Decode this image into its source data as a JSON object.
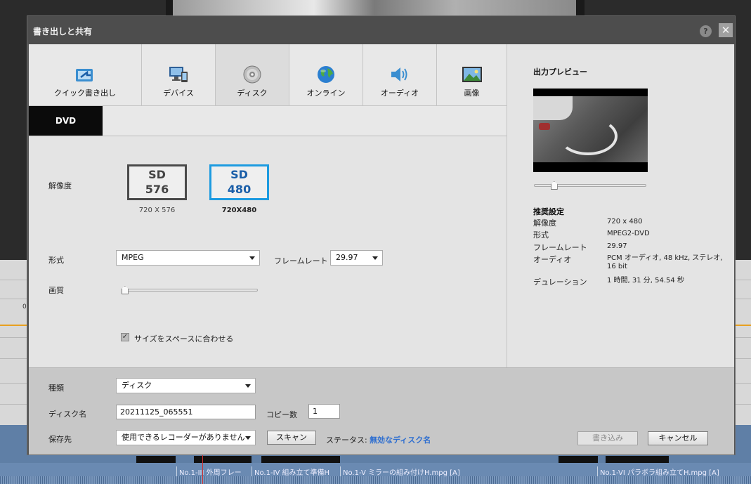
{
  "dialog": {
    "title": "書き出しと共有",
    "help_label": "?",
    "close_label": "✕"
  },
  "tabs": [
    {
      "label": "クイック書き出し",
      "icon": "quick-export-icon"
    },
    {
      "label": "デバイス",
      "icon": "device-icon"
    },
    {
      "label": "ディスク",
      "icon": "disc-icon",
      "active": true
    },
    {
      "label": "オンライン",
      "icon": "globe-icon"
    },
    {
      "label": "オーディオ",
      "icon": "speaker-icon"
    },
    {
      "label": "画像",
      "icon": "image-icon"
    }
  ],
  "subtab": {
    "label": "DVD"
  },
  "settings": {
    "resolution_label": "解像度",
    "options": [
      {
        "top": "SD",
        "bottom": "576",
        "caption": "720 X 576",
        "selected": false
      },
      {
        "top": "SD",
        "bottom": "480",
        "caption": "720X480",
        "selected": true
      }
    ],
    "format_label": "形式",
    "format_value": "MPEG",
    "framerate_label": "フレームレート",
    "framerate_value": "29.97",
    "quality_label": "画質",
    "quality_level": 0.02,
    "fit_label": "サイズをスペースに合わせる",
    "fit_checked": true,
    "fit_mark": "✓"
  },
  "preview": {
    "title": "出力プレビュー",
    "scrub_position": 0.18,
    "recommended_title": "推奨設定",
    "items": [
      {
        "key": "解像度",
        "value": "720 x 480"
      },
      {
        "key": "形式",
        "value": "MPEG2-DVD"
      },
      {
        "key": "フレームレート",
        "value": "29.97"
      },
      {
        "key": "オーディオ",
        "value": "PCM オーディオ, 48 kHz, ステレオ, 16 bit"
      },
      {
        "key": "デュレーション",
        "value": "1 時間, 31 分, 54.54 秒"
      }
    ]
  },
  "bottom": {
    "type_label": "種類",
    "type_value": "ディスク",
    "disc_name_label": "ディスク名",
    "disc_name_value": "20211125_065551",
    "copies_label": "コピー数",
    "copies_value": "1",
    "save_to_label": "保存先",
    "save_to_value": "使用できるレコーダーがありません",
    "scan_label": "スキャン",
    "status_label": "ステータス:",
    "status_value": "無効なディスク名",
    "burn_label": "書き込み",
    "cancel_label": "キャンセル"
  },
  "timeline": {
    "clips": [
      "No.1-III 外周フレー",
      "No.1-IV 組み立て準備H",
      "No.1-V ミラーの組み付けH.mpg [A]",
      "No.1-VI パラボラ組み立てH.mpg [A]"
    ],
    "ruler_mark": "0"
  },
  "colors": {
    "accent": "#1d9be0",
    "status_invalid": "#2f6fd0",
    "timeline": "#6a8ab2"
  }
}
